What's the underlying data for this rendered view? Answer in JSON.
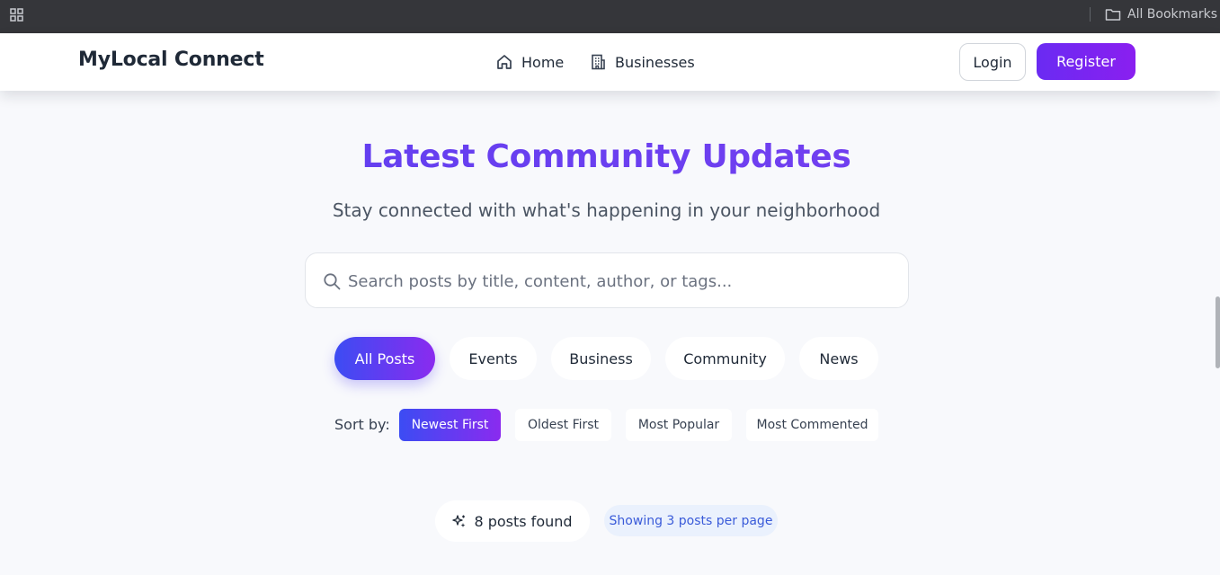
{
  "browser": {
    "bookmarks_label": "All Bookmarks"
  },
  "navbar": {
    "brand": "MyLocal Connect",
    "links": [
      {
        "label": "Home",
        "icon": "home-icon"
      },
      {
        "label": "Businesses",
        "icon": "building-icon"
      }
    ],
    "login_label": "Login",
    "register_label": "Register"
  },
  "hero": {
    "title": "Latest Community Updates",
    "subtitle": "Stay connected with what's happening in your neighborhood"
  },
  "search": {
    "placeholder": "Search posts by title, content, author, or tags...",
    "value": ""
  },
  "categories": {
    "items": [
      "All Posts",
      "Events",
      "Business",
      "Community",
      "News"
    ],
    "active": "All Posts"
  },
  "sort": {
    "label": "Sort by:",
    "options": [
      "Newest First",
      "Oldest First",
      "Most Popular",
      "Most Commented"
    ],
    "active": "Newest First"
  },
  "results": {
    "count_text": "8 posts found",
    "per_page_text": "Showing 3 posts per page"
  },
  "colors": {
    "accent_start": "#3c4cf3",
    "accent_end": "#8a2bef",
    "register_bg": "#6a2bf2",
    "page_bg": "#f8f9fc",
    "chrome_bar": "#35363a"
  }
}
